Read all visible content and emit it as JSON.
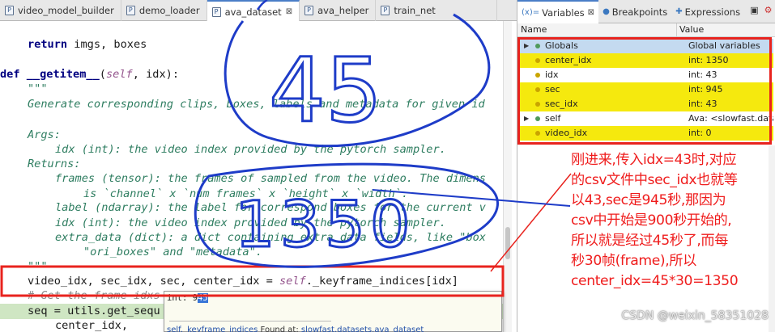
{
  "editor_tabs": [
    {
      "label": "video_model_builder",
      "active": false
    },
    {
      "label": "demo_loader",
      "active": false
    },
    {
      "label": "ava_dataset",
      "active": true
    },
    {
      "label": "ava_helper",
      "active": false
    },
    {
      "label": "train_net",
      "active": false
    }
  ],
  "code": {
    "return_kw": "return",
    "return_rest": " imgs, boxes",
    "def_kw": "def",
    "def_name": " __getitem__",
    "def_self": "self",
    "def_args_open": "(",
    "def_args_rest": ", idx):",
    "doc_open": "\"\"\"",
    "doc_summary": "Generate corresponding clips, boxes, labels and metadata for given id",
    "doc_args": "Args:",
    "doc_idx": "idx (int): the video index provided by the pytorch sampler.",
    "doc_returns": "Returns:",
    "doc_frames": "frames (tensor): the frames of sampled from the video. The dimens",
    "doc_frames_2": "is `channel` x `num frames` x `height` x `width`.",
    "doc_label": "label (ndarray): the label for correspond boxes for the current v",
    "doc_idx2": "idx (int): the video index provided by the pytorch sampler.",
    "doc_extra": "extra_data (dict): a dict containing extra data fields, like \"box",
    "doc_extra_2": "\"ori_boxes\" and \"metadata\".",
    "doc_close": "\"\"\"",
    "assign_lhs": "video_idx, sec_idx, sec, center_idx = ",
    "assign_self": "self",
    "assign_rhs": "._keyframe_indices[idx]",
    "comment": "# Get the frame idxs",
    "seq_line": "seq = utils.get_sequ",
    "center_line": "center_idx,"
  },
  "hover": {
    "value_prefix": "int: 9",
    "value_selected": "45",
    "footer_sym": "self._keyframe_indices",
    "footer_found": " Found at: ",
    "footer_loc": "slowfast.datasets.ava_dataset"
  },
  "panel_tabs": [
    {
      "icon": "(x)=",
      "label": "Variables",
      "active": true
    },
    {
      "icon": "●",
      "label": "Breakpoints",
      "active": false
    },
    {
      "icon": "✚",
      "label": "Expressions",
      "active": false
    }
  ],
  "variables": {
    "col_name": "Name",
    "col_value": "Value",
    "rows": [
      {
        "name": "Globals",
        "value": "Global variables",
        "style": "selected",
        "twisty": "▶",
        "dot": "green",
        "indent": 0
      },
      {
        "name": "center_idx",
        "value": "int: 1350",
        "style": "yellow",
        "twisty": "",
        "dot": "yel",
        "indent": 1
      },
      {
        "name": "idx",
        "value": "int: 43",
        "style": "plain",
        "twisty": "",
        "dot": "yel",
        "indent": 1
      },
      {
        "name": "sec",
        "value": "int: 945",
        "style": "yellow",
        "twisty": "",
        "dot": "yel",
        "indent": 1
      },
      {
        "name": "sec_idx",
        "value": "int: 43",
        "style": "yellow",
        "twisty": "",
        "dot": "yel",
        "indent": 1
      },
      {
        "name": "self",
        "value": "Ava: <slowfast.datase",
        "style": "plain",
        "twisty": "▶",
        "dot": "green",
        "indent": 0
      },
      {
        "name": "video_idx",
        "value": "int: 0",
        "style": "yellow",
        "twisty": "",
        "dot": "yel",
        "indent": 1
      }
    ]
  },
  "annotation_note": "刚进来,传入idx=43时,对应\n的csv文件中sec_idx也就等\n以43,sec是945秒,那因为\ncsv中开始是900秒开始的,\n所以就是经过45秒了,而每\n秒30帧(frame),所以\ncenter_idx=45*30=1350",
  "handwriting": {
    "top": "45",
    "bottom": "1350"
  },
  "watermark": "CSDN @weixin_58351028",
  "colors": {
    "annotation": "#e8231e",
    "ink": "#1e3cc8",
    "highlight_yellow": "#f5e90e",
    "current_line": "#cfe6c3"
  }
}
